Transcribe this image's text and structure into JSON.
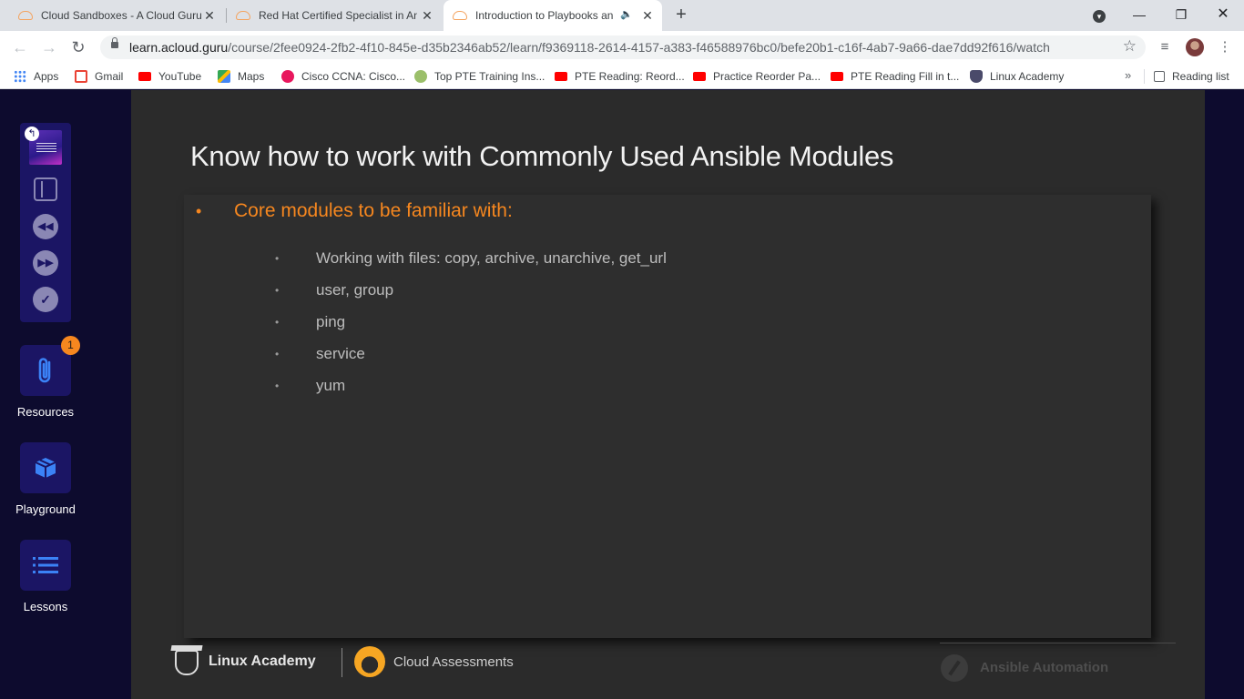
{
  "browser": {
    "tabs": [
      {
        "title": "Cloud Sandboxes - A Cloud Guru"
      },
      {
        "title": "Red Hat Certified Specialist in An"
      },
      {
        "title": "Introduction to Playbooks an"
      }
    ],
    "new_tab_glyph": "+",
    "url_domain": "learn.acloud.guru",
    "url_path": "/course/2fee0924-2fb2-4f10-845e-d35b2346ab52/learn/f9369118-2614-4157-a383-f46588976bc0/befe20b1-c16f-4ab7-9a66-dae7dd92f616/watch",
    "bookmarks": [
      {
        "label": "Apps",
        "icon": "apps-grid-icon"
      },
      {
        "label": "Gmail",
        "icon": "gmail-icon"
      },
      {
        "label": "YouTube",
        "icon": "youtube-icon"
      },
      {
        "label": "Maps",
        "icon": "maps-icon"
      },
      {
        "label": "Cisco CCNA: Cisco...",
        "icon": "cisco-icon"
      },
      {
        "label": "Top PTE Training Ins...",
        "icon": "pte-icon"
      },
      {
        "label": "PTE Reading: Reord...",
        "icon": "youtube-icon"
      },
      {
        "label": "Practice Reorder Pa...",
        "icon": "youtube-icon"
      },
      {
        "label": "PTE Reading Fill in t...",
        "icon": "youtube-icon"
      },
      {
        "label": "Linux Academy",
        "icon": "linux-academy-icon"
      }
    ],
    "more_bookmarks": "»",
    "reading_list": "Reading list"
  },
  "sidebar": {
    "resources_label": "Resources",
    "resources_badge": "1",
    "playground_label": "Playground",
    "lessons_label": "Lessons"
  },
  "slide": {
    "title": "Know how to work with Commonly Used Ansible Modules",
    "lead_bullet": "Core modules to be familiar with:",
    "items": [
      "Working with files: copy, archive, unarchive, get_url",
      "user, group",
      "ping",
      "service",
      "yum"
    ],
    "bullet_glyph": "•",
    "footer": {
      "brand1": "Linux Academy",
      "brand2": "Cloud Assessments",
      "brand3": "Ansible Automation"
    }
  },
  "colors": {
    "accent_orange": "#f6871f",
    "rail_bg": "#0d0b2e",
    "button_bg": "#1b1564",
    "slide_bg": "#2b2b2b"
  }
}
